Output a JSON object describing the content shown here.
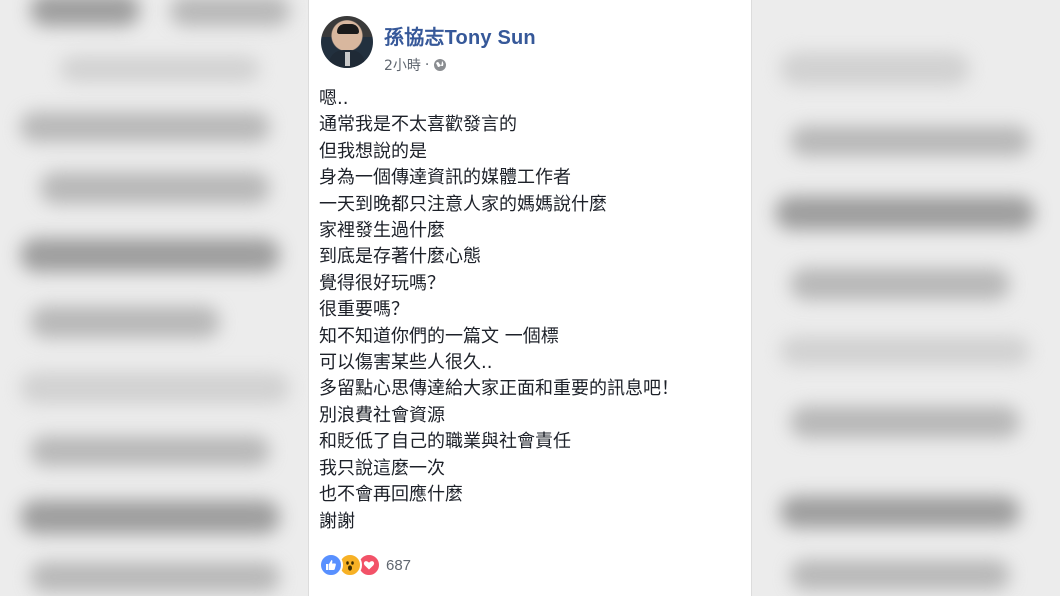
{
  "post": {
    "author": "孫協志Tony Sun",
    "timestamp": "2小時",
    "separator": "·",
    "lines": [
      "嗯..",
      "通常我是不太喜歡發言的",
      "但我想說的是",
      "身為一個傳達資訊的媒體工作者",
      "一天到晚都只注意人家的媽媽說什麼",
      "家裡發生過什麼",
      "到底是存著什麼心態",
      "覺得很好玩嗎？",
      "很重要嗎？",
      "知不知道你們的一篇文 一個標",
      "可以傷害某些人很久..",
      "多留點心思傳達給大家正面和重要的訊息吧！",
      "別浪費社會資源",
      "和貶低了自己的職業與社會責任",
      "我只說這麼一次",
      "也不會再回應什麼",
      "謝謝"
    ],
    "reaction_count": "687",
    "reaction_icons": [
      "like-icon",
      "wow-icon",
      "love-icon"
    ],
    "privacy_icon": "globe-icon"
  },
  "colors": {
    "author_link": "#365899",
    "like": "#5890ff",
    "wow": "#f7b125",
    "love": "#f25268",
    "meta_text": "#606770"
  }
}
